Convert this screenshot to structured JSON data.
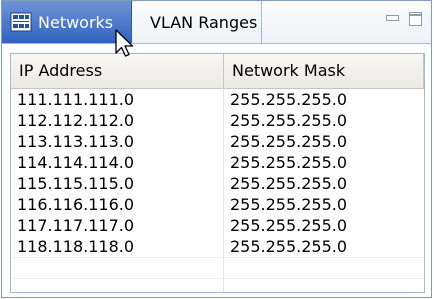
{
  "tabs": [
    {
      "label": "Networks",
      "icon": "network-icon",
      "active": true
    },
    {
      "label": "VLAN Ranges",
      "active": false
    }
  ],
  "window_controls": {
    "minimize_icon": "minimize-icon",
    "maximize_icon": "maximize-icon"
  },
  "table": {
    "columns": [
      "IP Address",
      "Network Mask"
    ],
    "rows": [
      {
        "ip": "111.111.111.0",
        "mask": "255.255.255.0"
      },
      {
        "ip": "112.112.112.0",
        "mask": "255.255.255.0"
      },
      {
        "ip": "113.113.113.0",
        "mask": "255.255.255.0"
      },
      {
        "ip": "114.114.114.0",
        "mask": "255.255.255.0"
      },
      {
        "ip": "115.115.115.0",
        "mask": "255.255.255.0"
      },
      {
        "ip": "116.116.116.0",
        "mask": "255.255.255.0"
      },
      {
        "ip": "117.117.117.0",
        "mask": "255.255.255.0"
      },
      {
        "ip": "118.118.118.0",
        "mask": "255.255.255.0"
      }
    ]
  },
  "colors": {
    "active_tab": "#3a6cc4",
    "border": "#7f9db9"
  }
}
